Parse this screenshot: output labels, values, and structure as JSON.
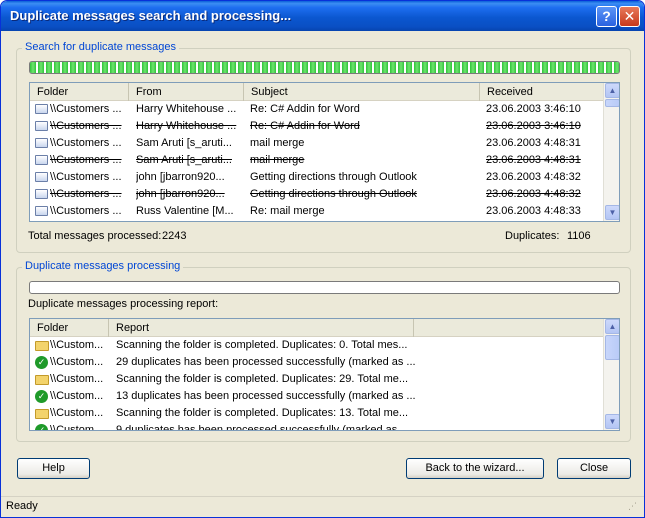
{
  "window": {
    "title": "Duplicate messages search and processing...",
    "help_glyph": "?",
    "close_glyph": "✕"
  },
  "search_group": {
    "legend": "Search for duplicate messages",
    "progress_fraction": 1.0,
    "columns": [
      "Folder",
      "From",
      "Subject",
      "Received"
    ],
    "rows": [
      {
        "folder": "\\\\Customers ...",
        "from": "Harry Whitehouse ...",
        "subject": "Re: C# Addin for Word",
        "received": "23.06.2003 3:46:10",
        "strike": false
      },
      {
        "folder": "\\\\Customers ...",
        "from": "Harry Whitehouse ...",
        "subject": "Re: C# Addin for Word",
        "received": "23.06.2003 3:46:10",
        "strike": true
      },
      {
        "folder": "\\\\Customers ...",
        "from": "Sam Aruti [s_aruti...",
        "subject": "mail merge",
        "received": "23.06.2003 4:48:31",
        "strike": false
      },
      {
        "folder": "\\\\Customers ...",
        "from": "Sam Aruti [s_aruti...",
        "subject": "mail merge",
        "received": "23.06.2003 4:48:31",
        "strike": true
      },
      {
        "folder": "\\\\Customers ...",
        "from": "john [jbarron920...",
        "subject": "Getting directions through Outlook",
        "received": "23.06.2003 4:48:32",
        "strike": false
      },
      {
        "folder": "\\\\Customers ...",
        "from": "john [jbarron920...",
        "subject": "Getting directions through Outlook",
        "received": "23.06.2003 4:48:32",
        "strike": true
      },
      {
        "folder": "\\\\Customers ...",
        "from": "Russ Valentine [M...",
        "subject": "Re: mail merge",
        "received": "23.06.2003 4:48:33",
        "strike": false
      }
    ],
    "total_label": "Total messages processed:",
    "total_value": "2243",
    "duplicates_label": "Duplicates:",
    "duplicates_value": "1106"
  },
  "processing_group": {
    "legend": "Duplicate messages processing",
    "progress_fraction": 0.0,
    "report_label": "Duplicate messages processing report:",
    "columns": [
      "Folder",
      "Report"
    ],
    "rows": [
      {
        "icon": "folder-icon",
        "folder": "\\\\Custom...",
        "report": "Scanning the folder is completed. Duplicates: 0. Total mes..."
      },
      {
        "icon": "check-icon",
        "folder": "\\\\Custom...",
        "report": "29 duplicates has been processed successfully (marked as ..."
      },
      {
        "icon": "folder-icon",
        "folder": "\\\\Custom...",
        "report": "Scanning the folder is completed. Duplicates: 29. Total me..."
      },
      {
        "icon": "check-icon",
        "folder": "\\\\Custom...",
        "report": "13 duplicates has been processed successfully (marked as ..."
      },
      {
        "icon": "folder-icon",
        "folder": "\\\\Custom...",
        "report": "Scanning the folder is completed. Duplicates: 13. Total me..."
      },
      {
        "icon": "check-icon",
        "folder": "\\\\Custom...",
        "report": "9 duplicates has been processed successfully (marked as ..."
      }
    ]
  },
  "buttons": {
    "help": "Help",
    "back": "Back to the wizard...",
    "close": "Close"
  },
  "status": {
    "text": "Ready"
  },
  "colors": {
    "titlebar": "#0a52d0",
    "legend_text": "#0046d5",
    "progress_green": "#2fc43a",
    "dialog_bg": "#ece9d8"
  }
}
